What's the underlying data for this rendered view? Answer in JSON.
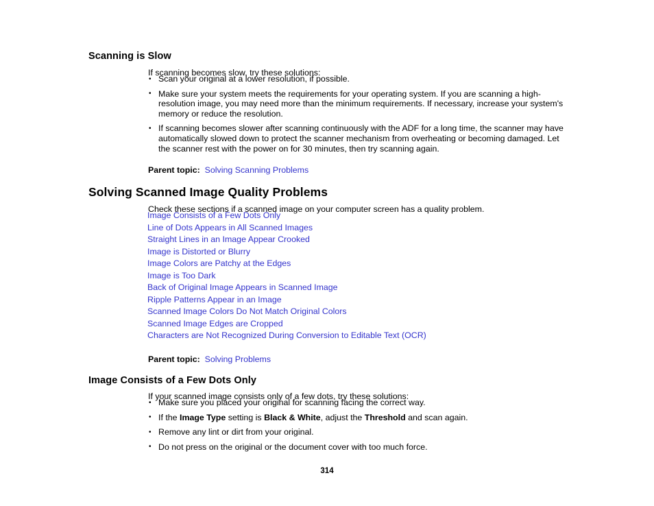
{
  "page": {
    "number": "314",
    "link_color": "#3333cc",
    "text_color": "#000000",
    "background": "#ffffff"
  },
  "section_slow": {
    "heading": "Scanning is Slow",
    "intro": "If scanning becomes slow, try these solutions:",
    "bullets": [
      "Scan your original at a lower resolution, if possible.",
      "Make sure your system meets the requirements for your operating system. If you are scanning a high-resolution image, you may need more than the minimum requirements. If necessary, increase your system's memory or reduce the resolution.",
      "If scanning becomes slower after scanning continuously with the ADF for a long time, the scanner may have automatically slowed down to protect the scanner mechanism from overheating or becoming damaged. Let the scanner rest with the power on for 30 minutes, then try scanning again."
    ],
    "parent_topic_label": "Parent topic:",
    "parent_topic_link": "Solving Scanning Problems"
  },
  "section_quality": {
    "heading": "Solving Scanned Image Quality Problems",
    "intro": "Check these sections if a scanned image on your computer screen has a quality problem.",
    "links": [
      "Image Consists of a Few Dots Only",
      "Line of Dots Appears in All Scanned Images",
      "Straight Lines in an Image Appear Crooked",
      "Image is Distorted or Blurry",
      "Image Colors are Patchy at the Edges",
      "Image is Too Dark",
      "Back of Original Image Appears in Scanned Image",
      "Ripple Patterns Appear in an Image",
      "Scanned Image Colors Do Not Match Original Colors",
      "Scanned Image Edges are Cropped",
      "Characters are Not Recognized During Conversion to Editable Text (OCR)"
    ],
    "parent_topic_label": "Parent topic:",
    "parent_topic_link": "Solving Problems"
  },
  "section_dots": {
    "heading": "Image Consists of a Few Dots Only",
    "intro": "If your scanned image consists only of a few dots, try these solutions:",
    "bullets": [
      {
        "text": "Make sure you placed your original for scanning facing the correct way."
      },
      {
        "parts": [
          {
            "t": "If the ",
            "bold": false
          },
          {
            "t": "Image Type",
            "bold": true
          },
          {
            "t": " setting is ",
            "bold": false
          },
          {
            "t": "Black & White",
            "bold": true
          },
          {
            "t": ", adjust the ",
            "bold": false
          },
          {
            "t": "Threshold",
            "bold": true
          },
          {
            "t": " and scan again.",
            "bold": false
          }
        ]
      },
      {
        "text": "Remove any lint or dirt from your original."
      },
      {
        "text": "Do not press on the original or the document cover with too much force."
      }
    ]
  }
}
